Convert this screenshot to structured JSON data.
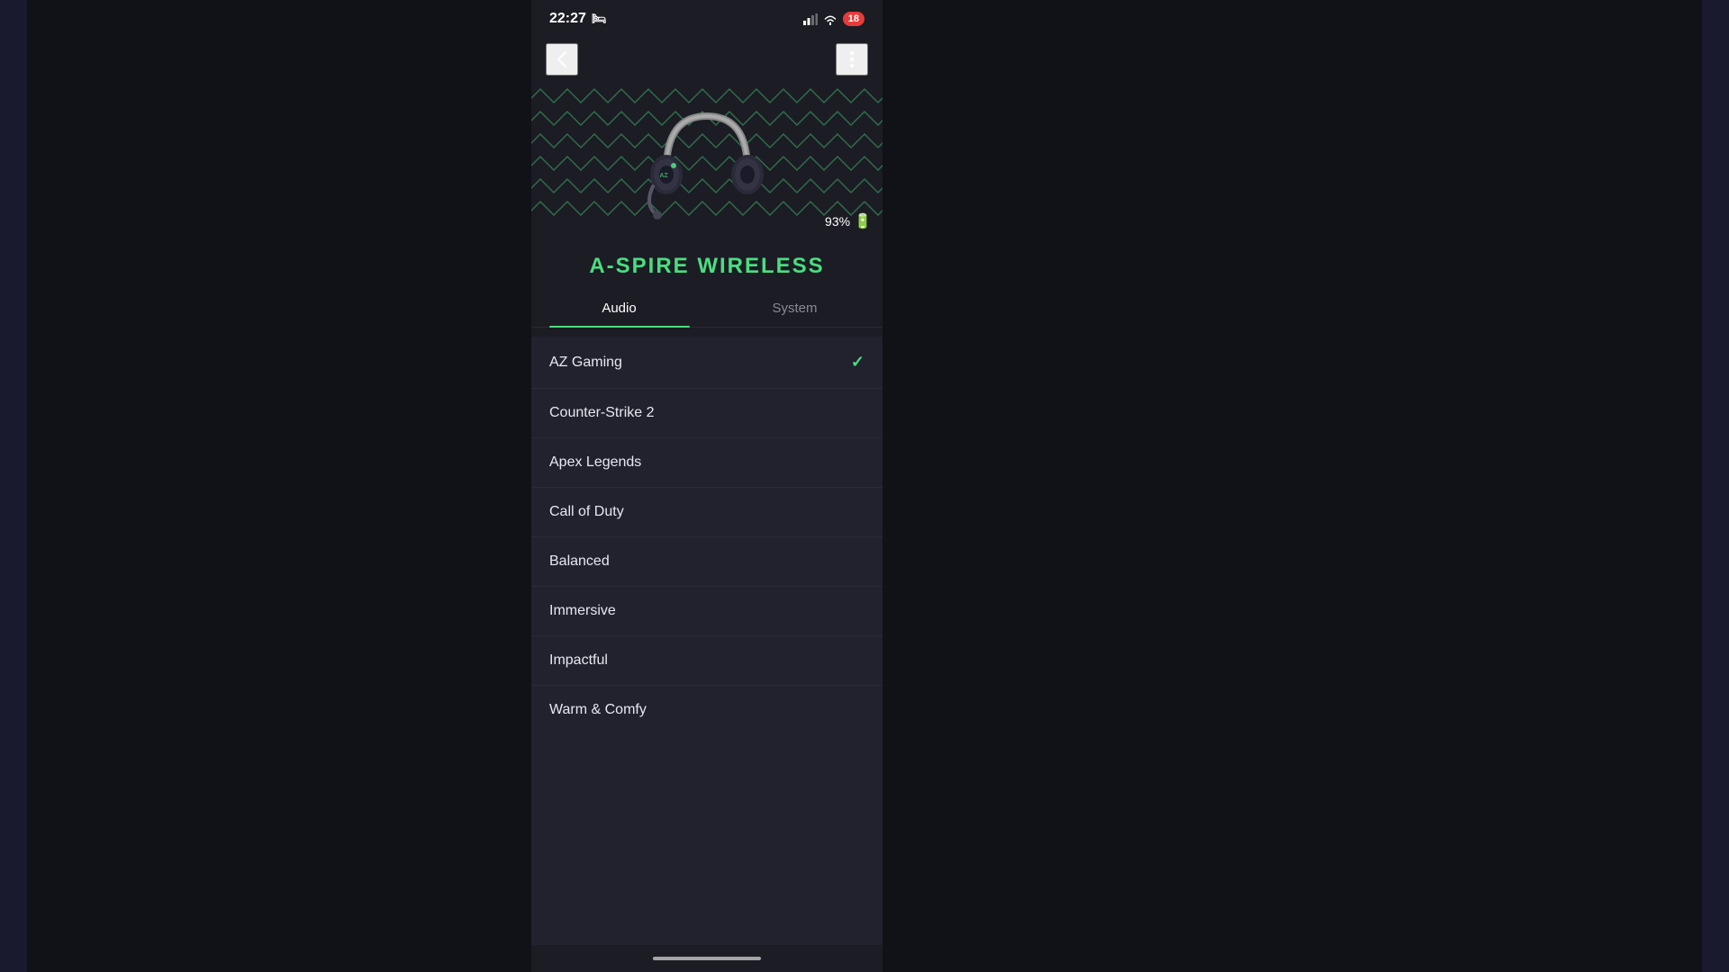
{
  "statusBar": {
    "time": "22:27",
    "notificationCount": "18"
  },
  "header": {
    "backLabel": "‹",
    "moreLabel": "⋮"
  },
  "product": {
    "name": "A-SPIRE WIRELESS",
    "batteryPercent": "93%"
  },
  "tabs": [
    {
      "id": "audio",
      "label": "Audio",
      "active": true
    },
    {
      "id": "system",
      "label": "System",
      "active": false
    }
  ],
  "presets": [
    {
      "id": "az-gaming",
      "label": "AZ Gaming",
      "selected": true
    },
    {
      "id": "counter-strike-2",
      "label": "Counter-Strike 2",
      "selected": false
    },
    {
      "id": "apex-legends",
      "label": "Apex Legends",
      "selected": false
    },
    {
      "id": "call-of-duty",
      "label": "Call of Duty",
      "selected": false
    },
    {
      "id": "balanced",
      "label": "Balanced",
      "selected": false
    },
    {
      "id": "immersive",
      "label": "Immersive",
      "selected": false
    },
    {
      "id": "impactful",
      "label": "Impactful",
      "selected": false
    },
    {
      "id": "warm-comfy",
      "label": "Warm & Comfy",
      "selected": false
    }
  ],
  "colors": {
    "accent": "#4ade80",
    "background": "#1c1c24",
    "listBackground": "#22222e",
    "text": "#e8e8f0",
    "subtleText": "#888899"
  }
}
